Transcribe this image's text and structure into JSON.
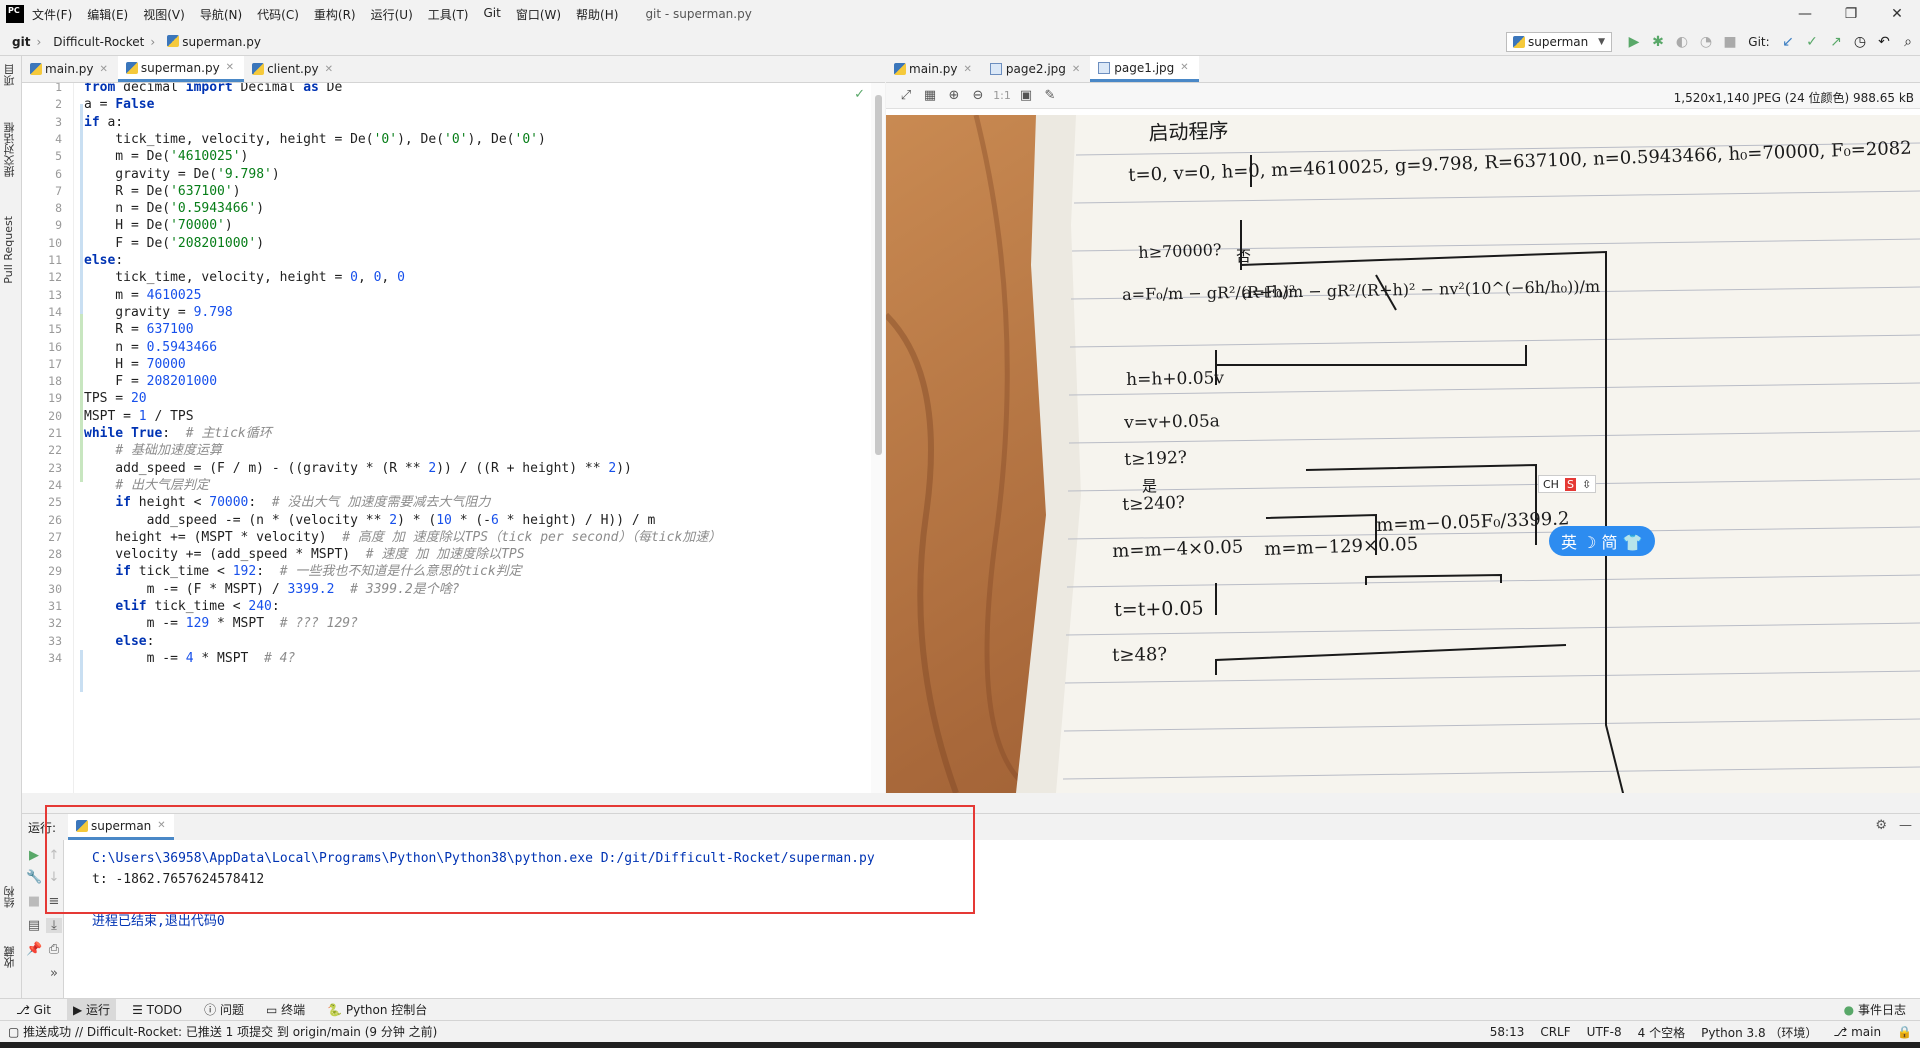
{
  "app": {
    "logo": "PC",
    "window_title": "git - superman.py",
    "menu": [
      "文件(F)",
      "编辑(E)",
      "视图(V)",
      "导航(N)",
      "代码(C)",
      "重构(R)",
      "运行(U)",
      "工具(T)",
      "Git",
      "窗口(W)",
      "帮助(H)"
    ]
  },
  "navbar": {
    "breadcrumbs": [
      "git",
      "Difficult-Rocket",
      "superman.py"
    ],
    "run_config": "superman",
    "git_label": "Git:"
  },
  "left_strip": {
    "tabs": [
      "项目",
      "提交对话框",
      "Pull Request",
      "结构",
      "收藏"
    ]
  },
  "editor": {
    "tabs": [
      {
        "label": "main.py",
        "active": false
      },
      {
        "label": "superman.py",
        "active": true
      },
      {
        "label": "client.py",
        "active": false
      }
    ],
    "lines": [
      {
        "n": "1",
        "tokens": [
          {
            "t": "from",
            "c": "kw"
          },
          {
            "t": " decimal ",
            "c": ""
          },
          {
            "t": "import",
            "c": "kw"
          },
          {
            "t": " Decimal ",
            "c": ""
          },
          {
            "t": "as",
            "c": "kw"
          },
          {
            "t": " De",
            "c": ""
          }
        ]
      },
      {
        "n": "2",
        "tokens": [
          {
            "t": "a = ",
            "c": ""
          },
          {
            "t": "False",
            "c": "kw"
          }
        ]
      },
      {
        "n": "3",
        "tokens": [
          {
            "t": "if",
            "c": "kw"
          },
          {
            "t": " a:",
            "c": ""
          }
        ]
      },
      {
        "n": "4",
        "tokens": [
          {
            "t": "    tick_time, velocity, height = De(",
            "c": ""
          },
          {
            "t": "'0'",
            "c": "str"
          },
          {
            "t": "), De(",
            "c": ""
          },
          {
            "t": "'0'",
            "c": "str"
          },
          {
            "t": "), De(",
            "c": ""
          },
          {
            "t": "'0'",
            "c": "str"
          },
          {
            "t": ")",
            "c": ""
          }
        ]
      },
      {
        "n": "5",
        "tokens": [
          {
            "t": "    m = De(",
            "c": ""
          },
          {
            "t": "'4610025'",
            "c": "str"
          },
          {
            "t": ")",
            "c": ""
          }
        ]
      },
      {
        "n": "6",
        "tokens": [
          {
            "t": "    gravity = De(",
            "c": ""
          },
          {
            "t": "'9.798'",
            "c": "str"
          },
          {
            "t": ")",
            "c": ""
          }
        ]
      },
      {
        "n": "7",
        "tokens": [
          {
            "t": "    R = De(",
            "c": ""
          },
          {
            "t": "'637100'",
            "c": "str"
          },
          {
            "t": ")",
            "c": ""
          }
        ]
      },
      {
        "n": "8",
        "tokens": [
          {
            "t": "    n = De(",
            "c": ""
          },
          {
            "t": "'0.5943466'",
            "c": "str"
          },
          {
            "t": ")",
            "c": ""
          }
        ]
      },
      {
        "n": "9",
        "tokens": [
          {
            "t": "    H = De(",
            "c": ""
          },
          {
            "t": "'70000'",
            "c": "str"
          },
          {
            "t": ")",
            "c": ""
          }
        ]
      },
      {
        "n": "10",
        "tokens": [
          {
            "t": "    F = De(",
            "c": ""
          },
          {
            "t": "'208201000'",
            "c": "str"
          },
          {
            "t": ")",
            "c": ""
          }
        ]
      },
      {
        "n": "11",
        "tokens": [
          {
            "t": "else",
            "c": "kw"
          },
          {
            "t": ":",
            "c": ""
          }
        ]
      },
      {
        "n": "12",
        "tokens": [
          {
            "t": "    tick_time, velocity, height = ",
            "c": ""
          },
          {
            "t": "0",
            "c": "num"
          },
          {
            "t": ", ",
            "c": ""
          },
          {
            "t": "0",
            "c": "num"
          },
          {
            "t": ", ",
            "c": ""
          },
          {
            "t": "0",
            "c": "num"
          }
        ]
      },
      {
        "n": "13",
        "tokens": [
          {
            "t": "    m = ",
            "c": ""
          },
          {
            "t": "4610025",
            "c": "num"
          }
        ]
      },
      {
        "n": "14",
        "tokens": [
          {
            "t": "    gravity = ",
            "c": ""
          },
          {
            "t": "9.798",
            "c": "num"
          }
        ]
      },
      {
        "n": "15",
        "tokens": [
          {
            "t": "    R = ",
            "c": ""
          },
          {
            "t": "637100",
            "c": "num"
          }
        ]
      },
      {
        "n": "16",
        "tokens": [
          {
            "t": "    n = ",
            "c": ""
          },
          {
            "t": "0.5943466",
            "c": "num"
          }
        ]
      },
      {
        "n": "17",
        "tokens": [
          {
            "t": "    H = ",
            "c": ""
          },
          {
            "t": "70000",
            "c": "num"
          }
        ]
      },
      {
        "n": "18",
        "tokens": [
          {
            "t": "    F = ",
            "c": ""
          },
          {
            "t": "208201000",
            "c": "num"
          }
        ]
      },
      {
        "n": "19",
        "tokens": [
          {
            "t": "TPS = ",
            "c": ""
          },
          {
            "t": "20",
            "c": "num"
          }
        ]
      },
      {
        "n": "20",
        "tokens": [
          {
            "t": "MSPT = ",
            "c": ""
          },
          {
            "t": "1",
            "c": "num"
          },
          {
            "t": " / TPS",
            "c": ""
          }
        ]
      },
      {
        "n": "21",
        "tokens": [
          {
            "t": "while",
            "c": "kw"
          },
          {
            "t": " ",
            "c": ""
          },
          {
            "t": "True",
            "c": "kw"
          },
          {
            "t": ":  ",
            "c": ""
          },
          {
            "t": "# 主tick循环",
            "c": "cm"
          }
        ]
      },
      {
        "n": "22",
        "tokens": [
          {
            "t": "    ",
            "c": ""
          },
          {
            "t": "# 基础加速度运算",
            "c": "cm"
          }
        ]
      },
      {
        "n": "23",
        "tokens": [
          {
            "t": "    add_speed = (F / m) - ((gravity * (R ** ",
            "c": ""
          },
          {
            "t": "2",
            "c": "num"
          },
          {
            "t": ")) / ((R + height) ** ",
            "c": ""
          },
          {
            "t": "2",
            "c": "num"
          },
          {
            "t": "))",
            "c": ""
          }
        ]
      },
      {
        "n": "24",
        "tokens": [
          {
            "t": "    ",
            "c": ""
          },
          {
            "t": "# 出大气层判定",
            "c": "cm"
          }
        ]
      },
      {
        "n": "25",
        "tokens": [
          {
            "t": "    ",
            "c": ""
          },
          {
            "t": "if",
            "c": "kw"
          },
          {
            "t": " height < ",
            "c": ""
          },
          {
            "t": "70000",
            "c": "num"
          },
          {
            "t": ":  ",
            "c": ""
          },
          {
            "t": "# 没出大气 加速度需要减去大气阻力",
            "c": "cm"
          }
        ]
      },
      {
        "n": "26",
        "tokens": [
          {
            "t": "        add_speed -= (n * (velocity ** ",
            "c": ""
          },
          {
            "t": "2",
            "c": "num"
          },
          {
            "t": ") * (",
            "c": ""
          },
          {
            "t": "10",
            "c": "num"
          },
          {
            "t": " * (-",
            "c": ""
          },
          {
            "t": "6",
            "c": "num"
          },
          {
            "t": " * height) / H)) / m",
            "c": ""
          }
        ]
      },
      {
        "n": "27",
        "tokens": [
          {
            "t": "    height += (MSPT * velocity)  ",
            "c": ""
          },
          {
            "t": "# 高度 加 速度除以TPS（tick per second）（每tick加速）",
            "c": "cm"
          }
        ]
      },
      {
        "n": "28",
        "tokens": [
          {
            "t": "    velocity += (add_speed * MSPT)  ",
            "c": ""
          },
          {
            "t": "# 速度 加 加速度除以TPS",
            "c": "cm"
          }
        ]
      },
      {
        "n": "29",
        "tokens": [
          {
            "t": "    ",
            "c": ""
          },
          {
            "t": "if",
            "c": "kw"
          },
          {
            "t": " tick_time < ",
            "c": ""
          },
          {
            "t": "192",
            "c": "num"
          },
          {
            "t": ":  ",
            "c": ""
          },
          {
            "t": "# 一些我也不知道是什么意思的tick判定",
            "c": "cm"
          }
        ]
      },
      {
        "n": "30",
        "tokens": [
          {
            "t": "        m -= (F * MSPT) / ",
            "c": ""
          },
          {
            "t": "3399.2",
            "c": "num"
          },
          {
            "t": "  ",
            "c": ""
          },
          {
            "t": "# 3399.2是个啥?",
            "c": "cm"
          }
        ]
      },
      {
        "n": "31",
        "tokens": [
          {
            "t": "    ",
            "c": ""
          },
          {
            "t": "elif",
            "c": "kw"
          },
          {
            "t": " tick_time < ",
            "c": ""
          },
          {
            "t": "240",
            "c": "num"
          },
          {
            "t": ":",
            "c": ""
          }
        ]
      },
      {
        "n": "32",
        "tokens": [
          {
            "t": "        m -= ",
            "c": ""
          },
          {
            "t": "129",
            "c": "num"
          },
          {
            "t": " * MSPT  ",
            "c": ""
          },
          {
            "t": "# ??? 129?",
            "c": "cm"
          }
        ]
      },
      {
        "n": "33",
        "tokens": [
          {
            "t": "    ",
            "c": ""
          },
          {
            "t": "else",
            "c": "kw"
          },
          {
            "t": ":",
            "c": ""
          }
        ]
      },
      {
        "n": "34",
        "tokens": [
          {
            "t": "        m -= ",
            "c": ""
          },
          {
            "t": "4",
            "c": "num"
          },
          {
            "t": " * MSPT  ",
            "c": ""
          },
          {
            "t": "# 4?",
            "c": "cm"
          }
        ]
      }
    ]
  },
  "viewer": {
    "tabs": [
      {
        "label": "main.py",
        "active": false
      },
      {
        "label": "page2.jpg",
        "active": false
      },
      {
        "label": "page1.jpg",
        "active": true
      }
    ],
    "zoom_label": "1:1",
    "image_info": "1,520x1,140 JPEG (24 位颜色) 988.65 kB",
    "handwriting": [
      "启动程序",
      "t=0, v=0, h=0, m=4610025, g=9.798, R=637100, n=0.5943466, h₀=70000, F₀=2082",
      "h≥70000?",
      "否",
      "a=F₀/m − gR²/(R+h)²",
      "a=F₀/m − gR²/(R+h)² − nv²(10^(−6h/h₀))/m",
      "h=h+0.05v",
      "v=v+0.05a",
      "t≥192?",
      "是",
      "t≥240?",
      "m=m−4×0.05",
      "m=m−129×0.05",
      "m=m−0.05F₀/3399.2",
      "t=t+0.05",
      "t≥48?"
    ],
    "ime_small": "CH",
    "ime_pill": "英 ☽ 简 👕"
  },
  "run": {
    "label": "运行:",
    "tab": "superman",
    "output": [
      "C:\\Users\\36958\\AppData\\Local\\Programs\\Python\\Python38\\python.exe D:/git/Difficult-Rocket/superman.py",
      "t: -1862.7657624578412",
      "",
      "进程已结束,退出代码0"
    ]
  },
  "toolwindows": [
    "Git",
    "运行",
    "TODO",
    "问题",
    "终端",
    "Python 控制台"
  ],
  "event_log": "事件日志",
  "status": {
    "message": "推送成功 // Difficult-Rocket: 已推送 1 项提交 到 origin/main (9 分钟 之前)",
    "position": "58:13",
    "line_sep": "CRLF",
    "encoding": "UTF-8",
    "indent": "4 个空格",
    "interpreter": "Python 3.8 （环境）",
    "branch": "main"
  },
  "colors": {
    "accent": "#4a88c7",
    "highlight_box": "#e53935"
  }
}
